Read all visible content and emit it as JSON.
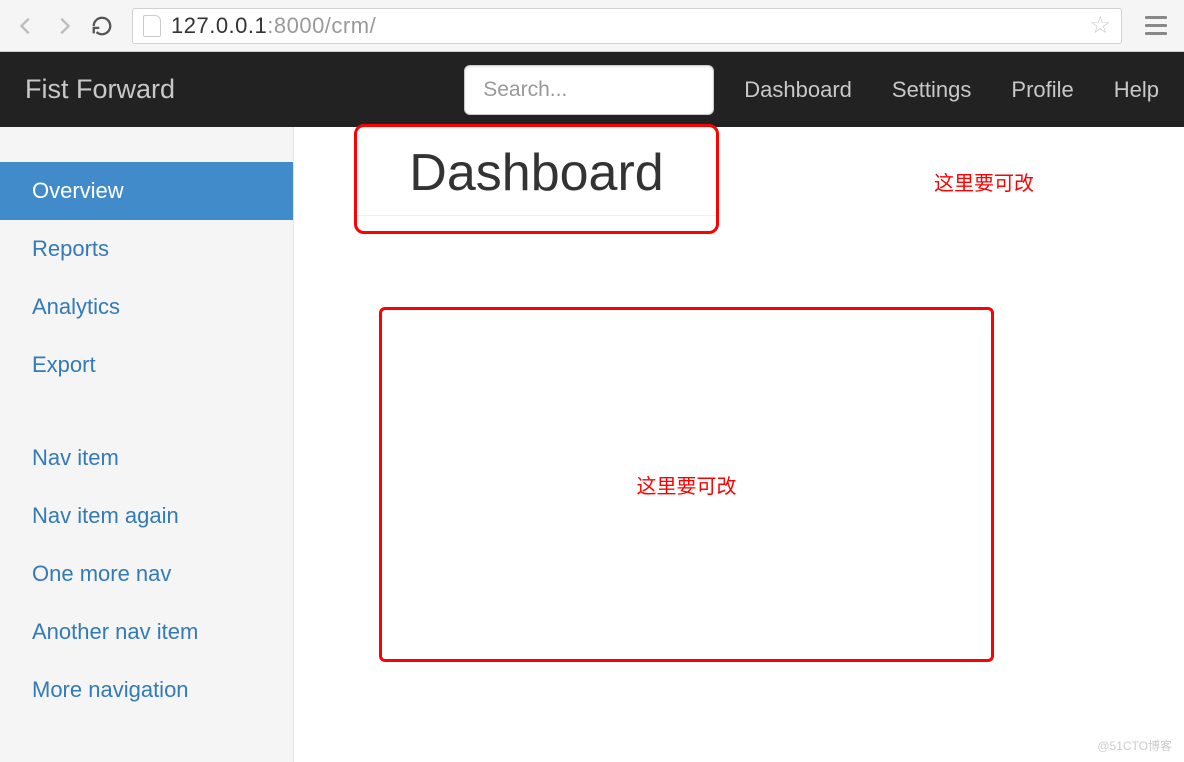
{
  "browser": {
    "url_host": "127.0.0.1",
    "url_rest": ":8000/crm/"
  },
  "navbar": {
    "brand": "Fist Forward",
    "search_placeholder": "Search...",
    "links": [
      "Dashboard",
      "Settings",
      "Profile",
      "Help"
    ]
  },
  "sidebar": {
    "group1": [
      "Overview",
      "Reports",
      "Analytics",
      "Export"
    ],
    "group2": [
      "Nav item",
      "Nav item again",
      "One more nav",
      "Another nav item",
      "More navigation"
    ],
    "active": "Overview"
  },
  "main": {
    "title": "Dashboard",
    "annotation1": "这里要可改",
    "annotation2": "这里要可改"
  },
  "watermark": "@51CTO博客"
}
